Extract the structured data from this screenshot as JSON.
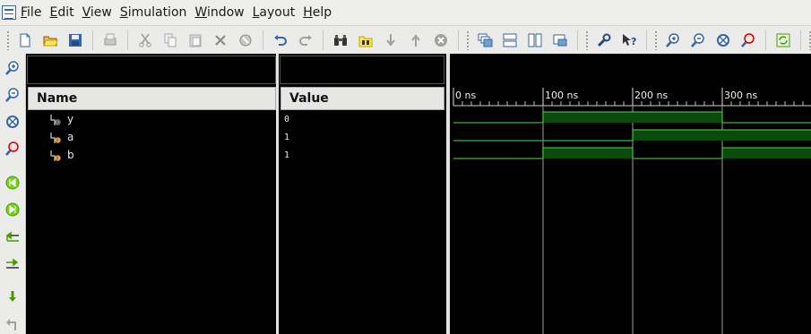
{
  "menubar": {
    "items": [
      {
        "mnemonic": "F",
        "rest": "ile"
      },
      {
        "mnemonic": "E",
        "rest": "dit"
      },
      {
        "mnemonic": "V",
        "rest": "iew"
      },
      {
        "mnemonic": "S",
        "rest": "imulation"
      },
      {
        "mnemonic": "W",
        "rest": "indow"
      },
      {
        "mnemonic": "L",
        "rest": "ayout"
      },
      {
        "mnemonic": "H",
        "rest": "elp"
      }
    ]
  },
  "panes": {
    "name_header": "Name",
    "value_header": "Value"
  },
  "signals": [
    {
      "name": "y",
      "value": "0",
      "type": "output"
    },
    {
      "name": "a",
      "value": "1",
      "type": "input"
    },
    {
      "name": "b",
      "value": "1",
      "type": "input"
    }
  ],
  "timeline": {
    "unit": "ns",
    "ticks": [
      "0 ns",
      "100 ns",
      "200 ns",
      "300 ns"
    ]
  },
  "waveform": {
    "segment_ns": 100,
    "segments": {
      "y": [
        0,
        1,
        1,
        0
      ],
      "a": [
        0,
        0,
        1,
        1
      ],
      "b": [
        0,
        1,
        0,
        1
      ]
    }
  },
  "colors": {
    "wave_line": "#4edc4e",
    "wave_high_fill": "#0a4a0a",
    "ui_bg": "#ebebe9"
  }
}
